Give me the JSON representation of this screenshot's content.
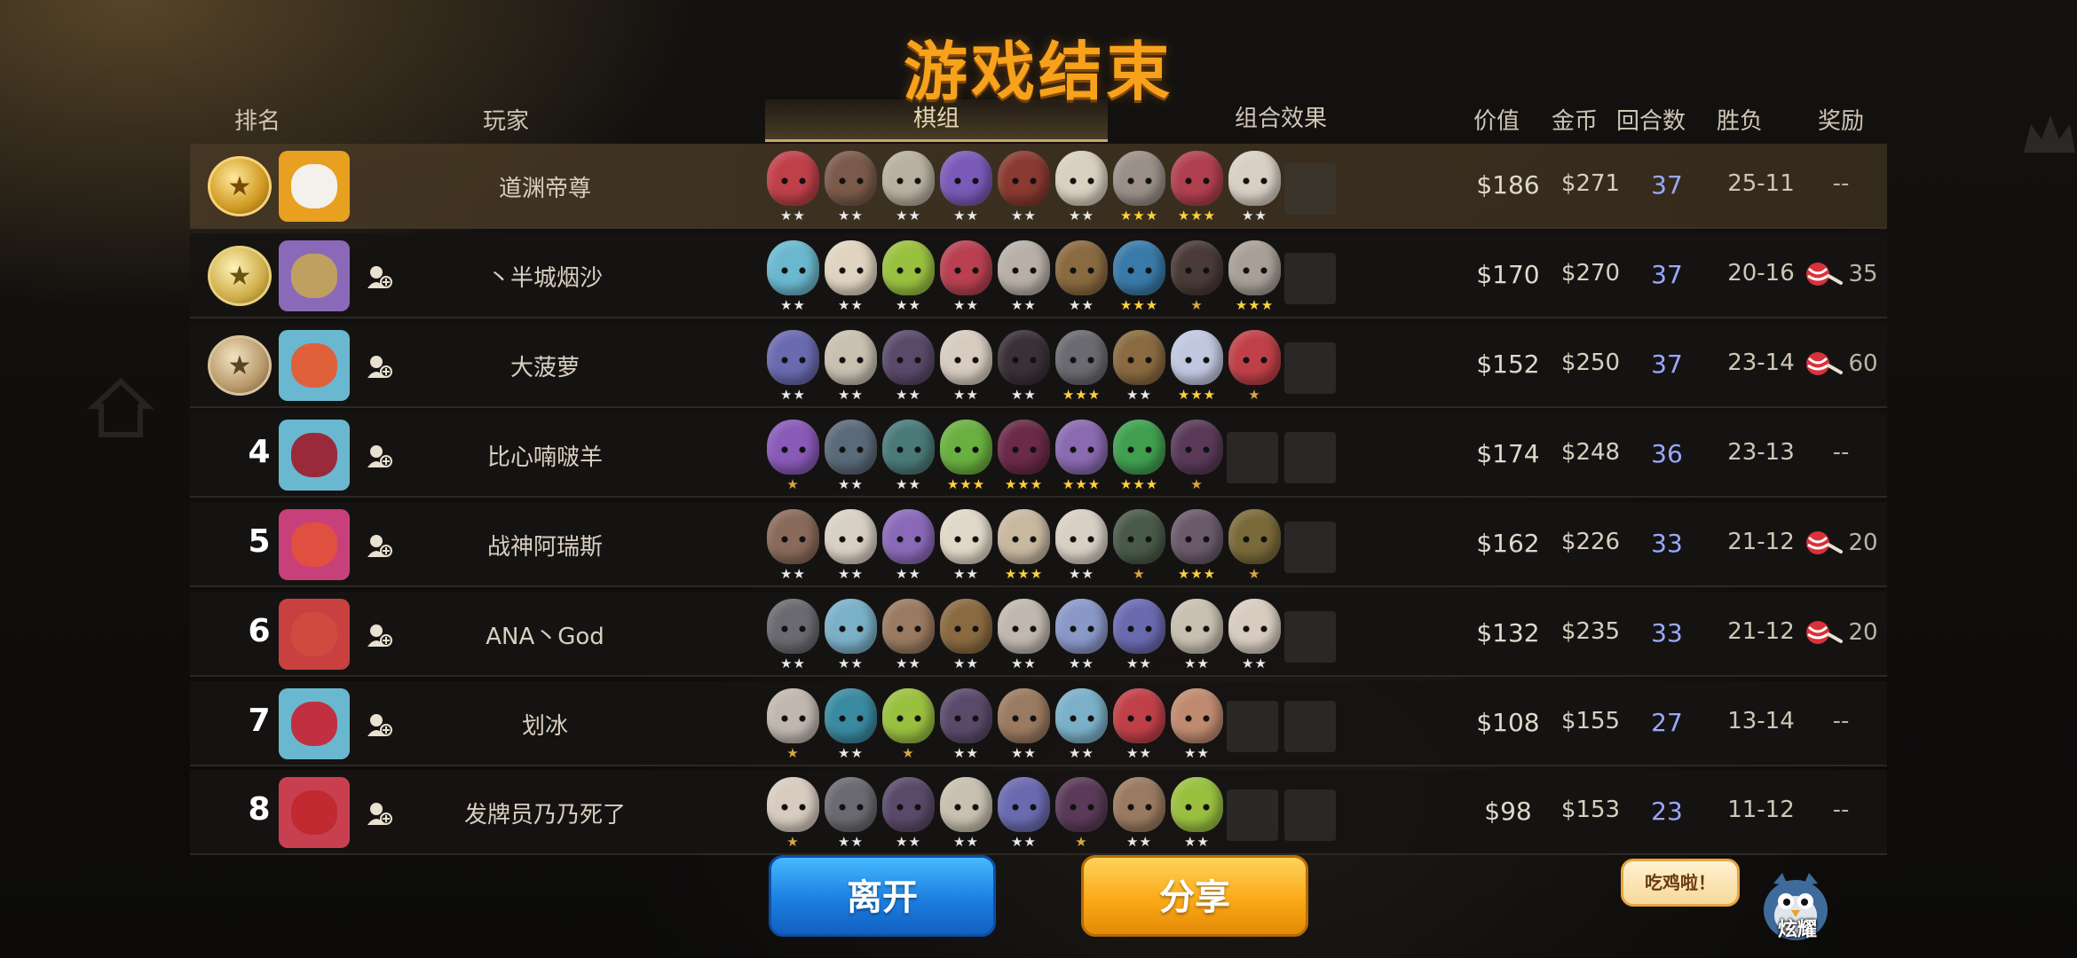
{
  "title": "游戏结束",
  "headers": {
    "rank": "排名",
    "player": "玩家",
    "lineup_tab": "棋组",
    "synergy_tab": "组合效果",
    "value": "价值",
    "gold": "金币",
    "rounds": "回合数",
    "win_loss": "胜负",
    "reward": "奖励"
  },
  "players": [
    {
      "rank": "",
      "medal": "gold",
      "name": "道渊帝尊",
      "value": "$186",
      "gold": "$271",
      "rounds": "37",
      "wl": "25-11",
      "reward": "--",
      "has_reward_icon": false,
      "pieces": [
        [
          "#c0404a",
          2
        ],
        [
          "#7a5a4a",
          2
        ],
        [
          "#b8b0a0",
          2
        ],
        [
          "#7a5ab8",
          2
        ],
        [
          "#8a3a30",
          2
        ],
        [
          "#d8d0c0",
          2
        ],
        [
          "#9a9088",
          3
        ],
        [
          "#b04050",
          3
        ],
        [
          "#d8d0c4",
          2
        ]
      ]
    },
    {
      "rank": "",
      "medal": "silver",
      "name": "丶半城烟沙",
      "value": "$170",
      "gold": "$270",
      "rounds": "37",
      "wl": "20-16",
      "reward": "35",
      "has_reward_icon": true,
      "pieces": [
        [
          "#6ab8d0",
          2
        ],
        [
          "#e0d4c0",
          2
        ],
        [
          "#9ac040",
          2
        ],
        [
          "#b84050",
          2
        ],
        [
          "#b8b0a8",
          2
        ],
        [
          "#8a6a40",
          2
        ],
        [
          "#3a7aa8",
          3
        ],
        [
          "#4a3a38",
          1
        ],
        [
          "#a8a098",
          3
        ]
      ]
    },
    {
      "rank": "",
      "medal": "bronze",
      "name": "大菠萝",
      "value": "$152",
      "gold": "$250",
      "rounds": "37",
      "wl": "23-14",
      "reward": "60",
      "has_reward_icon": true,
      "pieces": [
        [
          "#6a6ab0",
          2
        ],
        [
          "#c8c0b0",
          2
        ],
        [
          "#5a4a6a",
          2
        ],
        [
          "#d8ccc0",
          2
        ],
        [
          "#3a3038",
          2
        ],
        [
          "#6a6a70",
          3
        ],
        [
          "#8a6a40",
          2
        ],
        [
          "#c0c8e0",
          3
        ],
        [
          "#c04048",
          1
        ]
      ]
    },
    {
      "rank": "4",
      "medal": "",
      "name": "比心喃啵羊",
      "value": "$174",
      "gold": "$248",
      "rounds": "36",
      "wl": "23-13",
      "reward": "--",
      "has_reward_icon": false,
      "pieces": [
        [
          "#8a5ab8",
          1
        ],
        [
          "#5a6a78",
          2
        ],
        [
          "#4a7a78",
          2
        ],
        [
          "#6ab040",
          3
        ],
        [
          "#6a2a48",
          3
        ],
        [
          "#8a6ab0",
          3
        ],
        [
          "#40a050",
          3
        ],
        [
          "#5a3a58",
          1
        ]
      ]
    },
    {
      "rank": "5",
      "medal": "",
      "name": "战神阿瑞斯",
      "value": "$162",
      "gold": "$226",
      "rounds": "33",
      "wl": "21-12",
      "reward": "20",
      "has_reward_icon": true,
      "pieces": [
        [
          "#8a6a5a",
          2
        ],
        [
          "#d8d0c4",
          2
        ],
        [
          "#8a6ab8",
          2
        ],
        [
          "#e0d8c8",
          2
        ],
        [
          "#c8b8a0",
          3
        ],
        [
          "#d8d0c4",
          2
        ],
        [
          "#4a5a4a",
          1
        ],
        [
          "#6a5a6a",
          3
        ],
        [
          "#7a6a3a",
          1
        ]
      ]
    },
    {
      "rank": "6",
      "medal": "",
      "name": "ANA丶God",
      "value": "$132",
      "gold": "$235",
      "rounds": "33",
      "wl": "21-12",
      "reward": "20",
      "has_reward_icon": true,
      "pieces": [
        [
          "#6a6a70",
          2
        ],
        [
          "#7ab0c8",
          2
        ],
        [
          "#9a7a60",
          2
        ],
        [
          "#8a6a40",
          2
        ],
        [
          "#c0b8b0",
          2
        ],
        [
          "#8a98c8",
          2
        ],
        [
          "#6a6ab0",
          2
        ],
        [
          "#c8c0b0",
          2
        ],
        [
          "#d8ccc0",
          2
        ]
      ]
    },
    {
      "rank": "7",
      "medal": "",
      "name": "划冰",
      "value": "$108",
      "gold": "$155",
      "rounds": "27",
      "wl": "13-14",
      "reward": "--",
      "has_reward_icon": false,
      "pieces": [
        [
          "#c0b8b0",
          1
        ],
        [
          "#3a8aa0",
          2
        ],
        [
          "#9ac040",
          1
        ],
        [
          "#5a4a6a",
          2
        ],
        [
          "#9a7a60",
          2
        ],
        [
          "#7ab0c8",
          2
        ],
        [
          "#c04048",
          2
        ],
        [
          "#c08a70",
          2
        ]
      ]
    },
    {
      "rank": "8",
      "medal": "",
      "name": "发牌员乃乃死了",
      "value": "$98",
      "gold": "$153",
      "rounds": "23",
      "wl": "11-12",
      "reward": "--",
      "has_reward_icon": false,
      "pieces": [
        [
          "#d8ccc0",
          1
        ],
        [
          "#6a6a70",
          2
        ],
        [
          "#5a4a6a",
          2
        ],
        [
          "#c8c0b0",
          2
        ],
        [
          "#6a6ab0",
          2
        ],
        [
          "#5a3a58",
          1
        ],
        [
          "#9a7a60",
          2
        ],
        [
          "#9ac040",
          2
        ]
      ]
    }
  ],
  "buttons": {
    "leave": "离开",
    "share": "分享"
  },
  "brag": {
    "bubble": "吃鸡啦！",
    "label": "炫耀"
  },
  "colors": {
    "title": "#f8a21c",
    "round_text": "#9aa8ff",
    "leave": "#1b7fe0",
    "share": "#fba918"
  }
}
